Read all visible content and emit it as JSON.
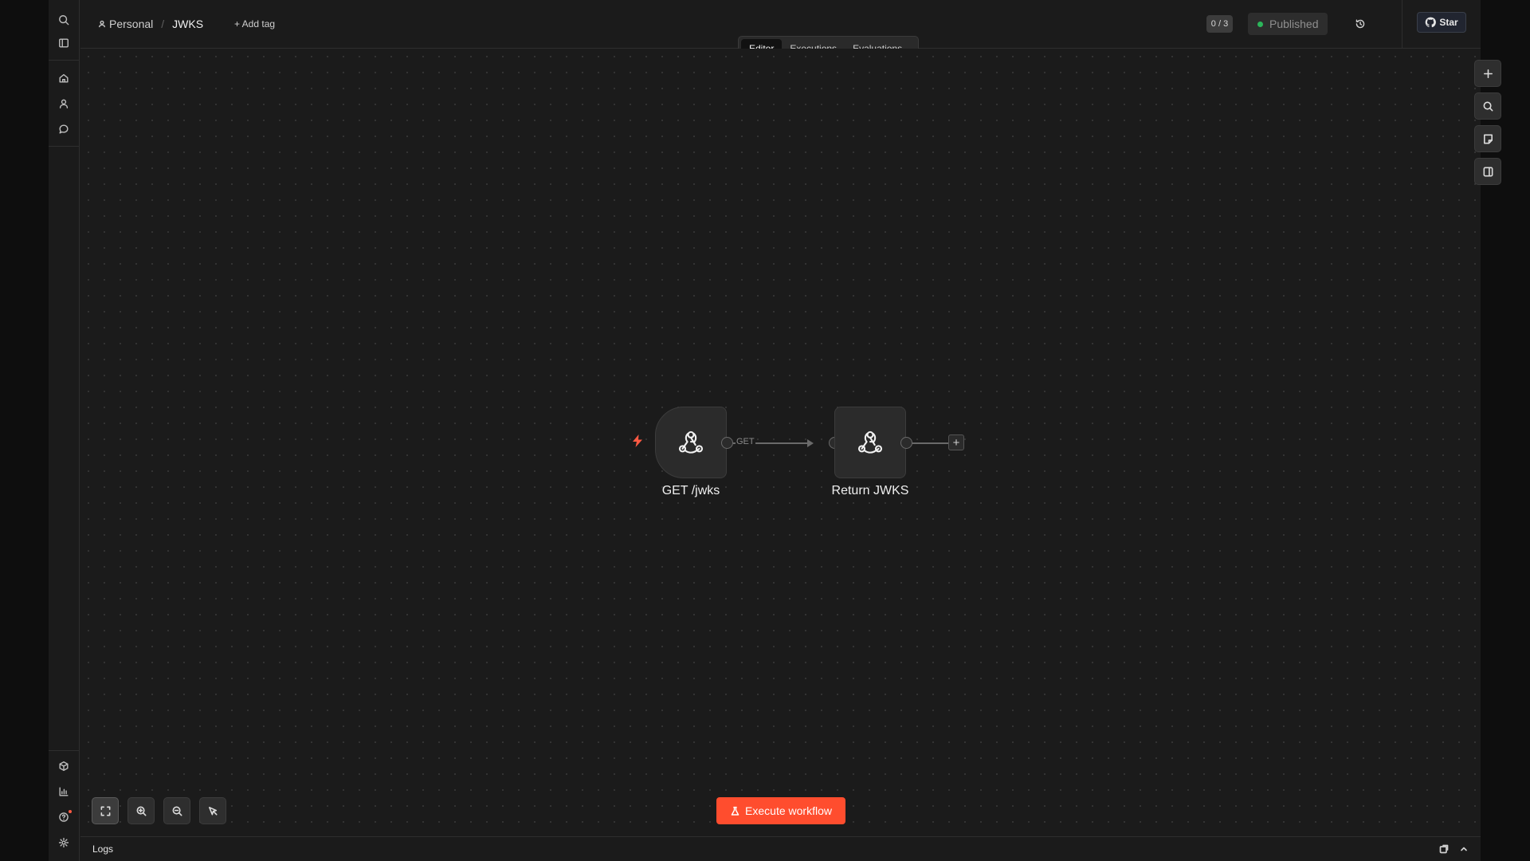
{
  "sidebar": {
    "top_icons": [
      "search-icon",
      "panel-toggle-icon",
      "home-icon",
      "user-icon",
      "chat-icon"
    ],
    "bottom_icons": [
      "templates-icon",
      "insights-icon",
      "help-icon",
      "settings-icon"
    ]
  },
  "header": {
    "breadcrumb": {
      "project": "Personal",
      "separator": "/",
      "workflow": "JWKS"
    },
    "add_tag": "+ Add tag",
    "counter": "0 / 3",
    "status": "Published",
    "status_color": "#2bb65a",
    "star_label": "Star"
  },
  "tabs": [
    {
      "label": "Editor",
      "active": true
    },
    {
      "label": "Executions",
      "active": false
    },
    {
      "label": "Evaluations",
      "active": false
    }
  ],
  "nodes": [
    {
      "label": "GET /jwks",
      "icon": "webhook-icon",
      "trigger": true
    },
    {
      "label": "Return JWKS",
      "icon": "webhook-icon",
      "trigger": false
    }
  ],
  "connection": {
    "label": "GET"
  },
  "canvas_tools": [
    "add-node-icon",
    "search-icon",
    "sticky-note-icon",
    "panel-icon"
  ],
  "zoom_tools": [
    "fit-view-icon",
    "zoom-in-icon",
    "zoom-out-icon",
    "pointer-icon"
  ],
  "execute_button": {
    "label": "Execute workflow",
    "color": "#ff4d2e"
  },
  "logs": {
    "title": "Logs"
  }
}
